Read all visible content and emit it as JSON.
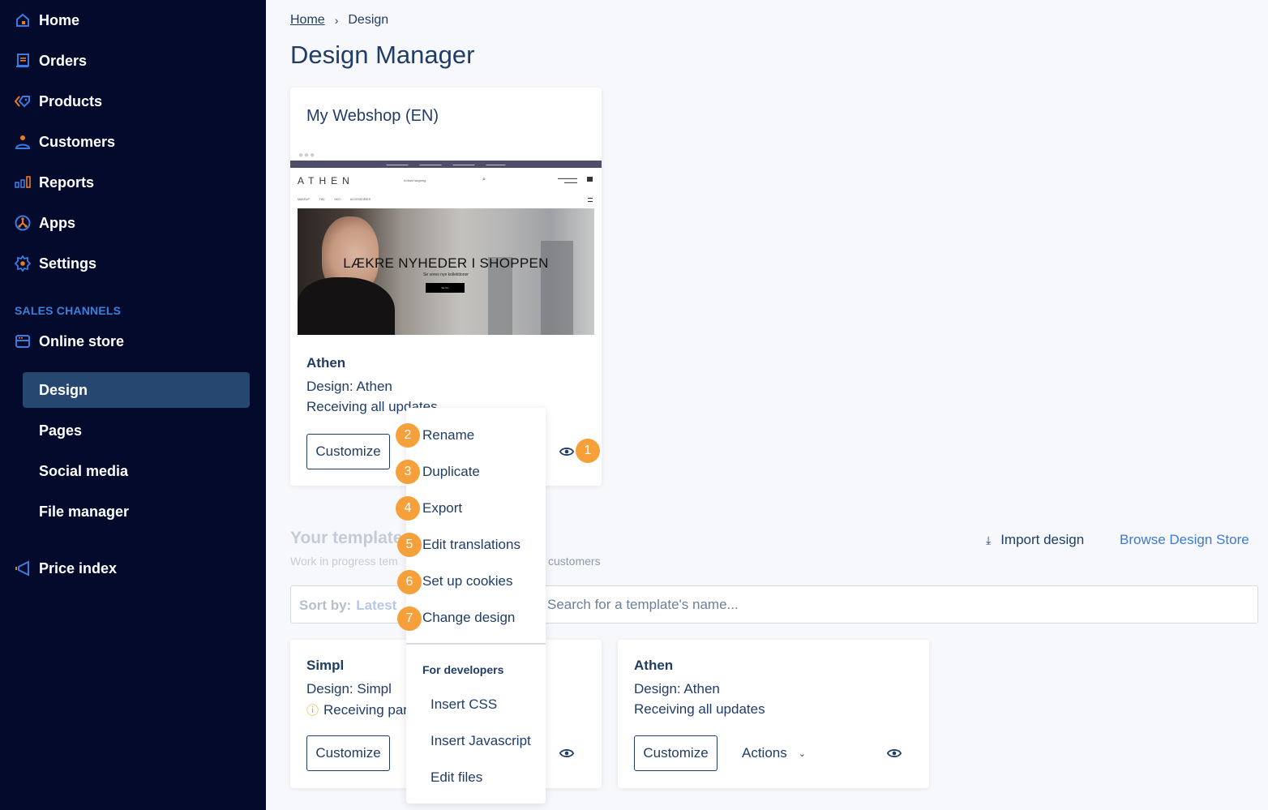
{
  "sidebar": {
    "items": [
      {
        "label": "Home",
        "icon": "home-icon"
      },
      {
        "label": "Orders",
        "icon": "orders-icon"
      },
      {
        "label": "Products",
        "icon": "tag-icon"
      },
      {
        "label": "Customers",
        "icon": "person-icon"
      },
      {
        "label": "Reports",
        "icon": "bar-chart-icon"
      },
      {
        "label": "Apps",
        "icon": "apps-icon"
      },
      {
        "label": "Settings",
        "icon": "gear-icon"
      }
    ],
    "section_label": "SALES CHANNELS",
    "online_store": {
      "label": "Online store",
      "icon": "store-icon"
    },
    "sub_items": [
      {
        "label": "Design",
        "active": true
      },
      {
        "label": "Pages"
      },
      {
        "label": "Social media"
      },
      {
        "label": "File manager"
      }
    ],
    "price_index": {
      "label": "Price index",
      "icon": "megaphone-icon"
    }
  },
  "breadcrumb": {
    "home": "Home",
    "current": "Design"
  },
  "page_title": "Design Manager",
  "main_card": {
    "shop_name": "My Webshop (EN)",
    "preview": {
      "logo": "ATHEN",
      "search_text": "Indtast søgning",
      "headline": "LÆKRE NYHEDER I SHOPPEN",
      "subline": "Se vores nye kollektioner",
      "button": "SE NU",
      "menu": [
        "MAKEUP",
        "TØJ",
        "SKO",
        "ACCESSORIES"
      ]
    },
    "template_name": "Athen",
    "design": "Design: Athen",
    "status": "Receiving all updates",
    "customize_label": "Customize",
    "badge": "1"
  },
  "menu": {
    "items": [
      {
        "label": "Rename",
        "badge": "2"
      },
      {
        "label": "Duplicate",
        "badge": "3"
      },
      {
        "label": "Export",
        "badge": "4"
      },
      {
        "label": "Edit translations",
        "badge": "5"
      },
      {
        "label": "Set up cookies",
        "badge": "6"
      },
      {
        "label": "Change design",
        "badge": "7"
      }
    ],
    "group_label": "For developers",
    "dev_items": [
      "Insert CSS",
      "Insert Javascript",
      "Edit files"
    ]
  },
  "templates": {
    "heading": "Your templates",
    "subtitle_left": "Work in progress tem",
    "subtitle_right": "customers",
    "import_label": "Import design",
    "browse_label": "Browse Design Store",
    "sort_label": "Sort by:",
    "sort_value": "Latest",
    "search_placeholder": "Search for a template's name...",
    "cards": [
      {
        "name": "Simpl",
        "design": "Design: Simpl",
        "status": "Receiving partial updates",
        "warning": true,
        "customize_label": "Customize"
      },
      {
        "name": "Athen",
        "design": "Design: Athen",
        "status": "Receiving all updates",
        "warning": false,
        "customize_label": "Customize",
        "actions_label": "Actions"
      }
    ]
  },
  "colors": {
    "sidebar_bg": "#030a2c",
    "active_item": "#26476f",
    "accent": "#3b7ad6",
    "badge": "#f5a03a",
    "text": "#1f3d66"
  }
}
